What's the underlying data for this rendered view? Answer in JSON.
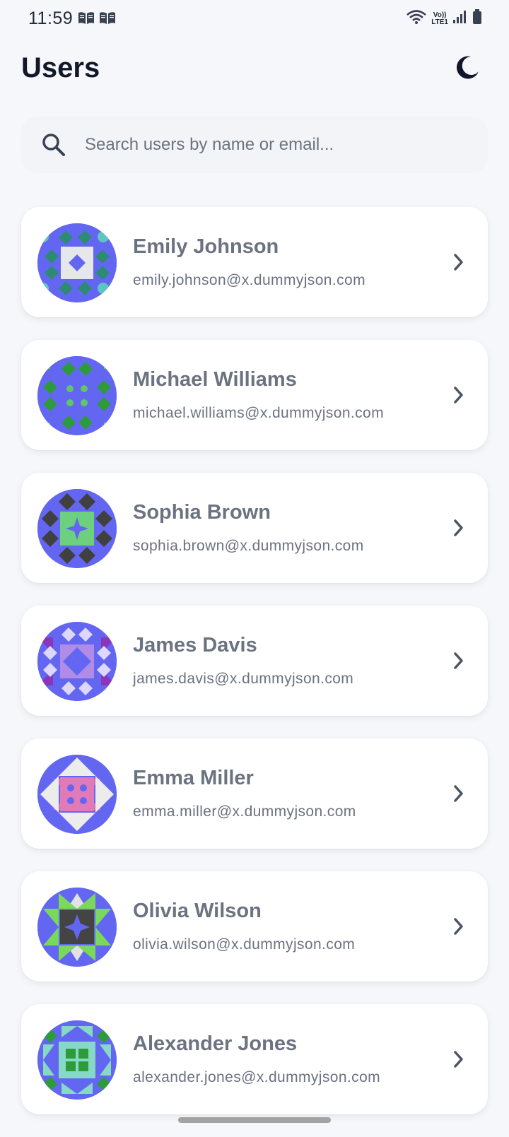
{
  "status_bar": {
    "time": "11:59",
    "left_icons": [
      "book-icon",
      "book-icon"
    ],
    "network_label_top": "Vo))",
    "network_label_bottom": "LTE1",
    "right_icons": [
      "wifi-icon",
      "volte-icon",
      "signal-icon",
      "battery-icon"
    ]
  },
  "header": {
    "title": "Users",
    "theme_toggle_icon": "moon-icon"
  },
  "search": {
    "placeholder": "Search users by name or email...",
    "value": ""
  },
  "colors": {
    "background": "#f6f7fa",
    "card": "#ffffff",
    "avatar_base": "#6366f1",
    "text_primary": "#111827",
    "text_muted": "#6b7280"
  },
  "users": [
    {
      "name": "Emily Johnson",
      "email": "emily.johnson@x.dummyjson.com",
      "avatar_colors": [
        "#6366f1",
        "#2e8b73",
        "#e5e7eb",
        "#5cc6c0"
      ]
    },
    {
      "name": "Michael Williams",
      "email": "michael.williams@x.dummyjson.com",
      "avatar_colors": [
        "#6366f1",
        "#2e9b3a",
        "#62c56a",
        "#62c56a"
      ]
    },
    {
      "name": "Sophia Brown",
      "email": "sophia.brown@x.dummyjson.com",
      "avatar_colors": [
        "#6366f1",
        "#404040",
        "#6dd07e",
        "#a5dfc9"
      ]
    },
    {
      "name": "James Davis",
      "email": "james.davis@x.dummyjson.com",
      "avatar_colors": [
        "#6366f1",
        "#ddd6fe",
        "#b08ce8",
        "#8b36b8"
      ]
    },
    {
      "name": "Emma Miller",
      "email": "emma.miller@x.dummyjson.com",
      "avatar_colors": [
        "#6366f1",
        "#ececec",
        "#e07ab9",
        "#d96fa8"
      ]
    },
    {
      "name": "Olivia Wilson",
      "email": "olivia.wilson@x.dummyjson.com",
      "avatar_colors": [
        "#6366f1",
        "#444444",
        "#7ad85a",
        "#e2e2e2"
      ]
    },
    {
      "name": "Alexander Jones",
      "email": "alexander.jones@x.dummyjson.com",
      "avatar_colors": [
        "#6366f1",
        "#86d9c5",
        "#2e9b3a",
        "#2e9b3a"
      ]
    }
  ]
}
